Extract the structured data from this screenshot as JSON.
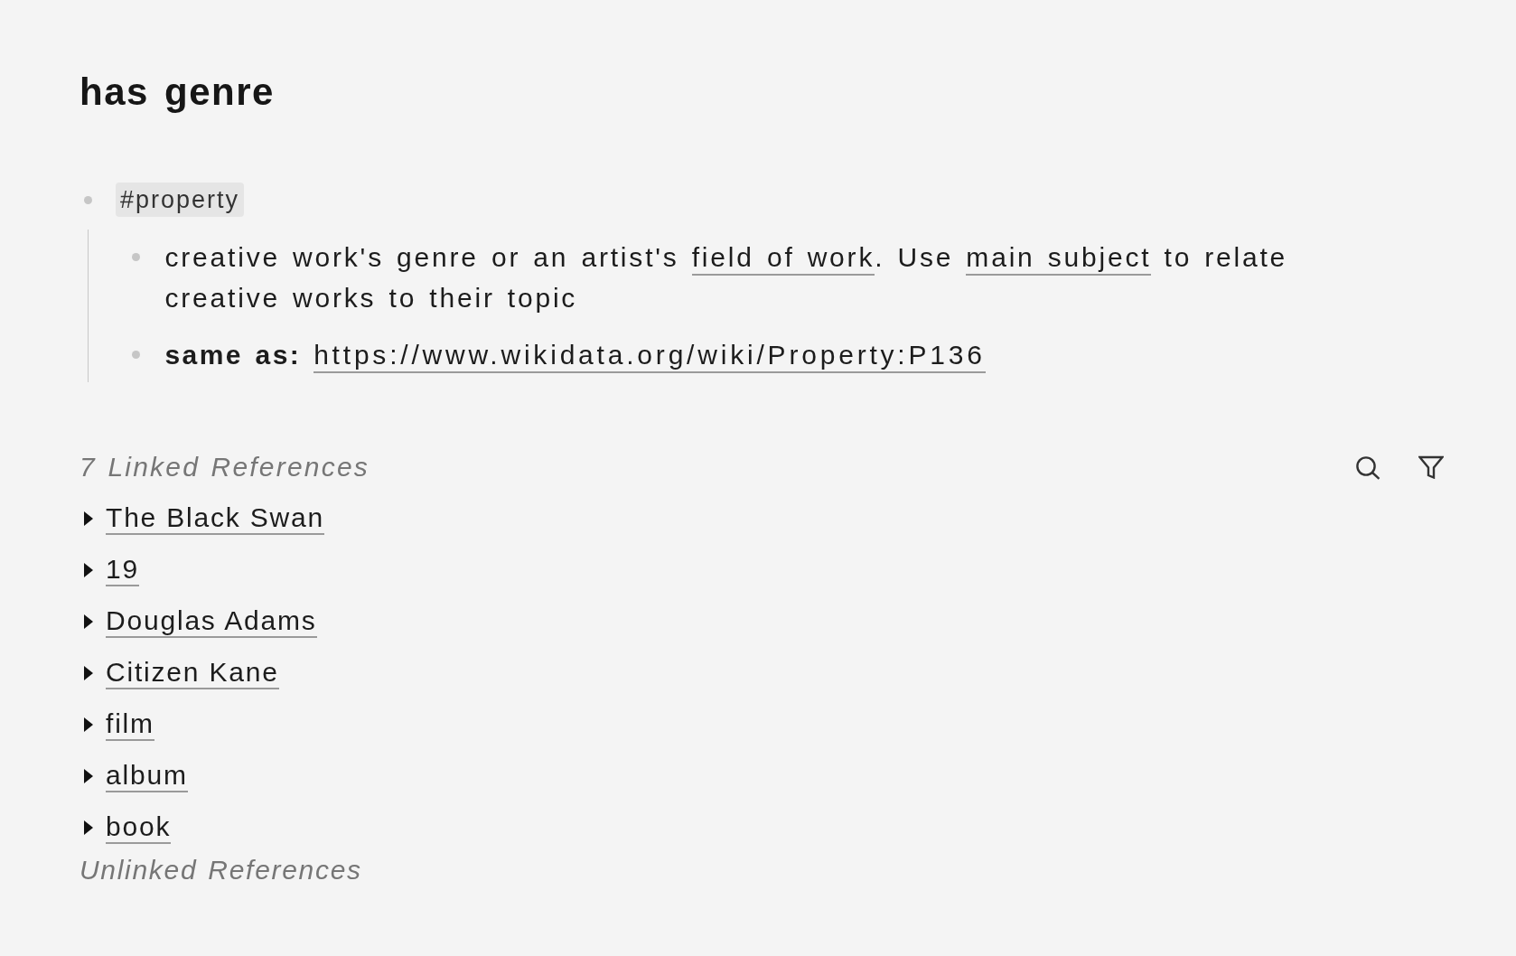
{
  "page": {
    "title": "has genre"
  },
  "blocks": [
    {
      "kind": "tag",
      "text": "#property",
      "children": [
        {
          "kind": "rich_text",
          "segments": [
            {
              "kind": "text",
              "text": "creative work's genre or an artist's "
            },
            {
              "kind": "link",
              "text": "field of work"
            },
            {
              "kind": "text",
              "text": ". Use "
            },
            {
              "kind": "link",
              "text": "main subject"
            },
            {
              "kind": "text",
              "text": " to relate creative works to their topic"
            }
          ]
        },
        {
          "kind": "property",
          "label": "same as:",
          "value": "https://www.wikidata.org/wiki/Property:P136"
        }
      ]
    }
  ],
  "linked_references": {
    "title": "7 Linked References",
    "items": [
      {
        "title": "The Black Swan",
        "expanded": false
      },
      {
        "title": "19",
        "expanded": false
      },
      {
        "title": "Douglas Adams",
        "expanded": false
      },
      {
        "title": "Citizen Kane",
        "expanded": false
      },
      {
        "title": "film",
        "expanded": false
      },
      {
        "title": "album",
        "expanded": false
      },
      {
        "title": "book",
        "expanded": false
      }
    ]
  },
  "unlinked_references": {
    "title": "Unlinked References"
  }
}
